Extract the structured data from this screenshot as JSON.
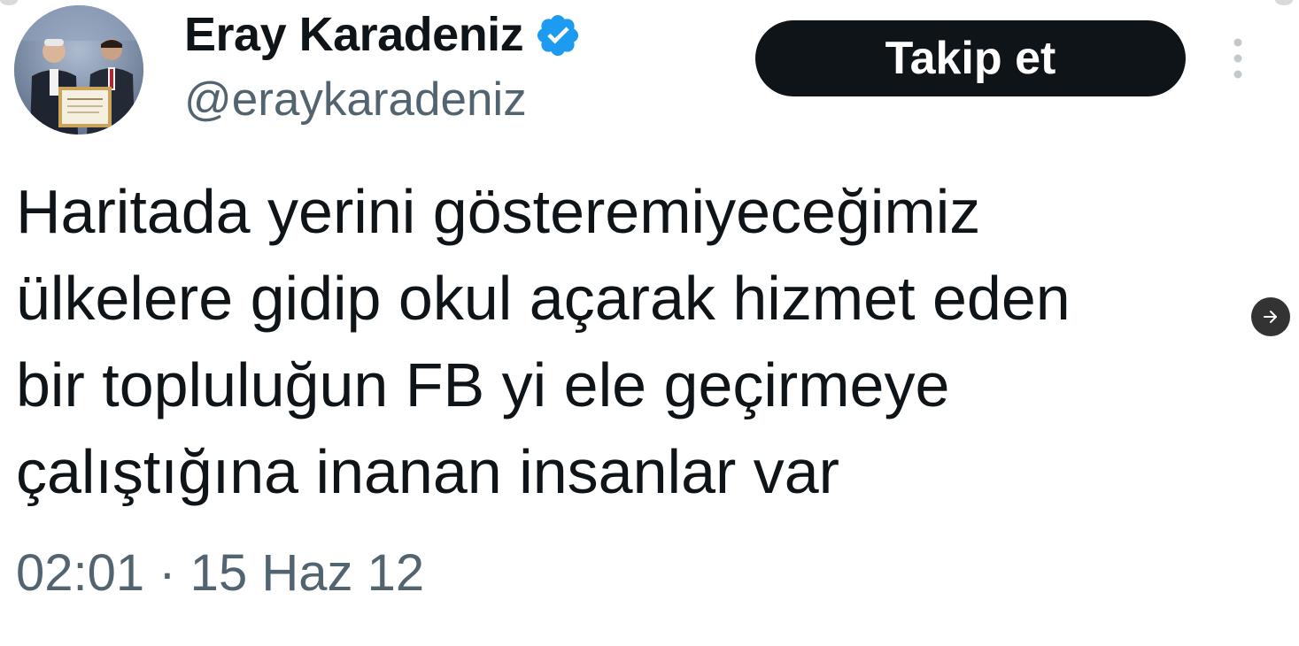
{
  "tweet": {
    "author": {
      "display_name": "Eray Karadeniz",
      "handle": "@eraykaradeniz",
      "verified": true,
      "verified_color": "#1d9bf0"
    },
    "follow_button_label": "Takip et",
    "more_icon": "more-vertical-icon",
    "text_lines": [
      "Haritada yerini gösteremiyeceğimiz",
      "ülkelere gidip okul açarak hizmet eden",
      "bir topluluğun FB yi ele geçirmeye",
      "çalıştığına inanan insanlar var"
    ],
    "timestamp": "02:01 · 15 Haz 12",
    "next_icon": "arrow-right-icon"
  },
  "colors": {
    "text_primary": "#0f1419",
    "text_secondary": "#536471",
    "button_bg": "#0f1419",
    "button_text": "#ffffff"
  }
}
